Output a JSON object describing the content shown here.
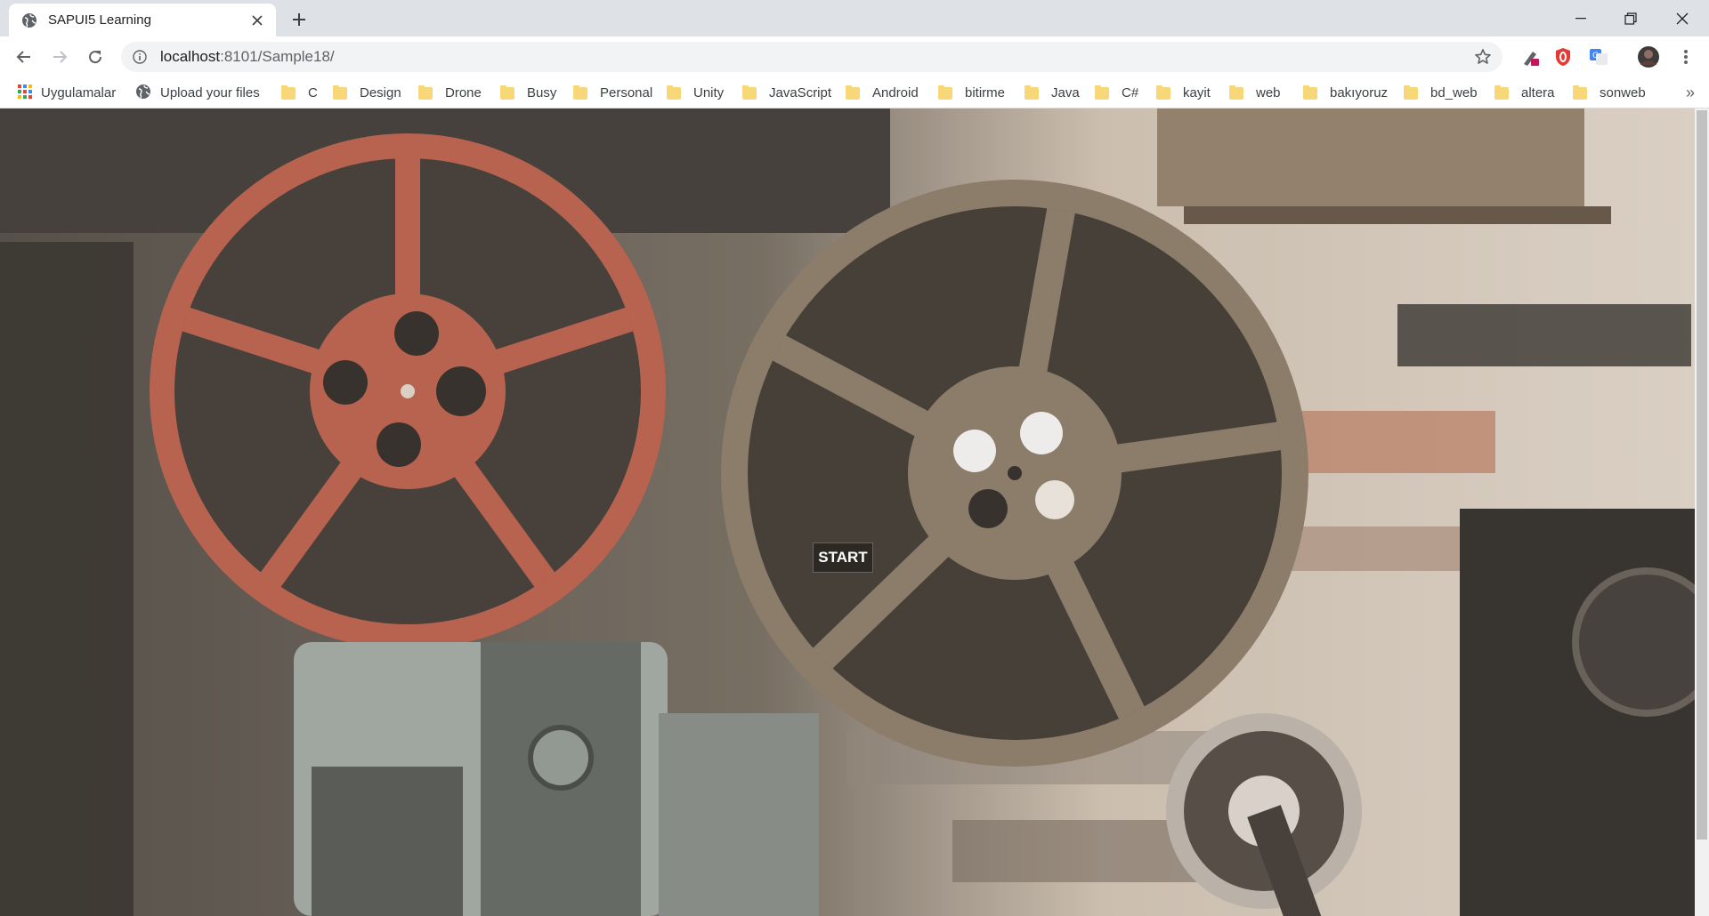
{
  "browser": {
    "tab": {
      "title": "SAPUI5 Learning"
    },
    "address": {
      "host": "localhost",
      "path": ":8101/Sample18/"
    }
  },
  "bookmarks": [
    {
      "label": "Uygulamalar",
      "icon": "apps-grid-icon"
    },
    {
      "label": "Upload your files",
      "icon": "globe-icon"
    },
    {
      "label": "C",
      "icon": "folder-icon"
    },
    {
      "label": "Design",
      "icon": "folder-icon"
    },
    {
      "label": "Drone",
      "icon": "folder-icon"
    },
    {
      "label": "Busy",
      "icon": "folder-icon"
    },
    {
      "label": "Personal",
      "icon": "folder-icon"
    },
    {
      "label": "Unity",
      "icon": "folder-icon"
    },
    {
      "label": "JavaScript",
      "icon": "folder-icon"
    },
    {
      "label": "Android",
      "icon": "folder-icon"
    },
    {
      "label": "bitirme",
      "icon": "folder-icon"
    },
    {
      "label": "Java",
      "icon": "folder-icon"
    },
    {
      "label": "C#",
      "icon": "folder-icon"
    },
    {
      "label": "kayit",
      "icon": "folder-icon"
    },
    {
      "label": "web",
      "icon": "folder-icon"
    },
    {
      "label": "bakıyoruz",
      "icon": "folder-icon"
    },
    {
      "label": "bd_web",
      "icon": "folder-icon"
    },
    {
      "label": "altera",
      "icon": "folder-icon"
    },
    {
      "label": "sonweb",
      "icon": "folder-icon"
    }
  ],
  "page": {
    "start_label": "START"
  },
  "colors": {
    "tabstrip_bg": "#dee1e6",
    "omnibox_bg": "#f1f3f4",
    "folder": "#f8d778"
  }
}
